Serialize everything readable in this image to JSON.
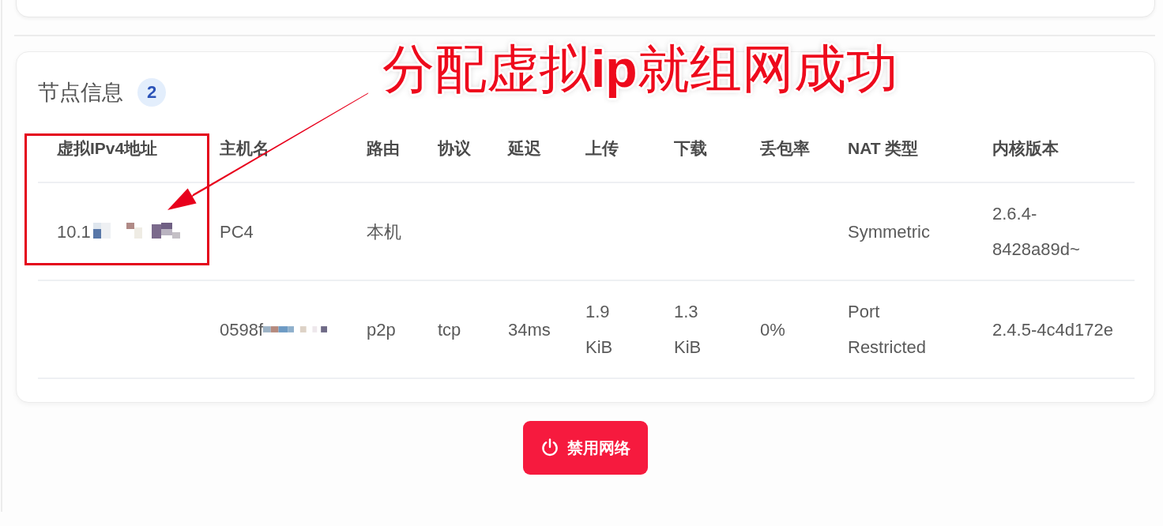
{
  "node_panel": {
    "title": "节点信息",
    "count": "2",
    "columns": [
      "虚拟IPv4地址",
      "主机名",
      "路由",
      "协议",
      "延迟",
      "上传",
      "下载",
      "丢包率",
      "NAT 类型",
      "内核版本"
    ],
    "rows": [
      {
        "virtual_ipv4": "10.1",
        "hostname": "PC4",
        "route": "本机",
        "nat_type": "Symmetric",
        "kernel_version": "2.6.4-8428a89d~",
        "masked": {
          "virtual_ipv4": true,
          "hostname": false
        }
      },
      {
        "hostname": "0598f",
        "route": "p2p",
        "protocol": "tcp",
        "latency": "34ms",
        "upload": "1.9 KiB",
        "download": "1.3 KiB",
        "loss_rate": "0%",
        "nat_type": "Port Restricted",
        "kernel_version": "2.4.5-4c4d172e",
        "masked": {
          "hostname": true
        }
      }
    ]
  },
  "disable_button": {
    "label": "禁用网络"
  },
  "annotation": {
    "text": "分配虚拟**ip**就组网成功"
  }
}
